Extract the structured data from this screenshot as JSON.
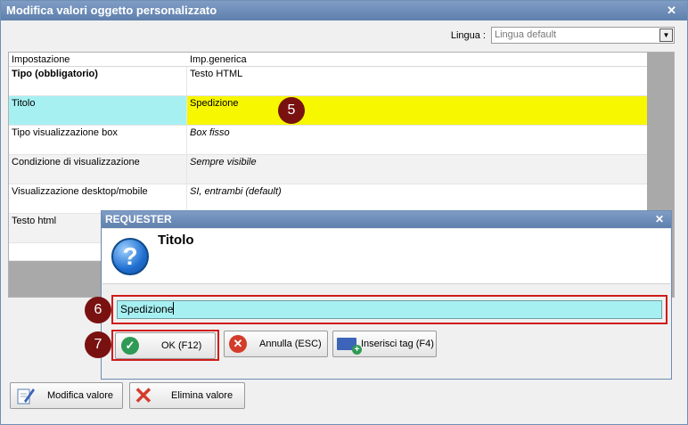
{
  "window": {
    "title": "Modifica valori oggetto personalizzato",
    "close_glyph": "✕"
  },
  "language": {
    "label": "Lingua :",
    "value": "Lingua default",
    "arrow": "▼"
  },
  "grid": {
    "headers": [
      "Impostazione",
      "Imp.generica"
    ],
    "rows": [
      {
        "setting": "Tipo (obbligatorio)",
        "value": "Testo HTML"
      },
      {
        "setting": "Titolo",
        "value": "Spedizione"
      },
      {
        "setting": "Tipo visualizzazione box",
        "value": "Box fisso"
      },
      {
        "setting": "Condizione di visualizzazione",
        "value": "Sempre visibile"
      },
      {
        "setting": "Visualizzazione desktop/mobile",
        "value": "SI, entrambi (default)"
      },
      {
        "setting": "Testo html",
        "value": ""
      }
    ]
  },
  "badges": [
    "5",
    "6",
    "7"
  ],
  "requester": {
    "title": "REQUESTER",
    "close_glyph": "✕",
    "heading": "Titolo",
    "icon_glyph": "?",
    "input_value": "Spedizione",
    "buttons": {
      "ok": "OK (F12)",
      "cancel": "Annulla (ESC)",
      "insert_tag": "Inserisci tag (F4)"
    }
  },
  "footer": {
    "edit": "Modifica valore",
    "delete": "Elimina valore"
  },
  "icons": {
    "ok": "check-circle-icon",
    "cancel": "x-circle-icon",
    "tag": "insert-tag-icon",
    "edit": "pencil-edit-icon",
    "delete": "red-x-icon"
  },
  "colors": {
    "selected_setting": "#a6f0f2",
    "selected_value": "#f7f700",
    "highlight_frame": "#d11a1a",
    "badge": "#7a1111"
  }
}
